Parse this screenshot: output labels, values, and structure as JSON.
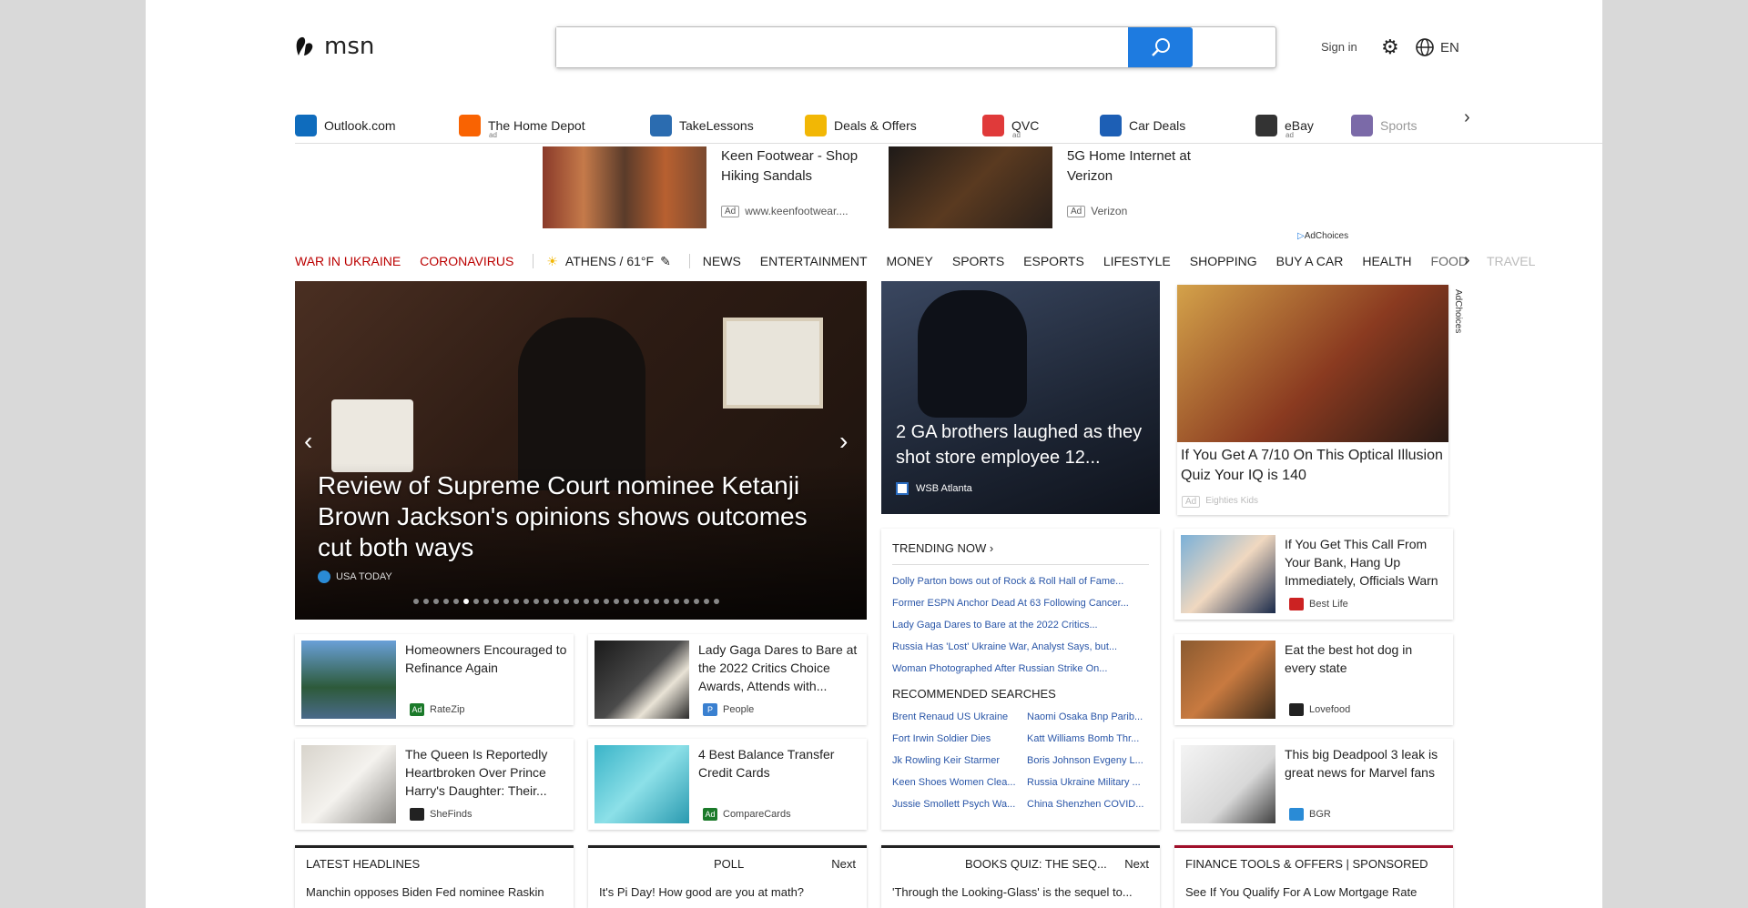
{
  "header": {
    "logo_text": "msn",
    "search_placeholder": "",
    "sign_in": "Sign in",
    "language": "EN"
  },
  "quick_links": [
    {
      "label": "Outlook.com",
      "ad": "",
      "icon": "outlook-icon",
      "color": "#0f6cbd"
    },
    {
      "label": "The Home Depot",
      "ad": "ad",
      "icon": "home-depot-icon",
      "color": "#f96302"
    },
    {
      "label": "TakeLessons",
      "ad": "",
      "icon": "takelessons-icon",
      "color": "#2b6cb0"
    },
    {
      "label": "Deals & Offers",
      "ad": "",
      "icon": "deals-icon",
      "color": "#f2b705"
    },
    {
      "label": "QVC",
      "ad": "ad",
      "icon": "qvc-icon",
      "color": "#e03a3a"
    },
    {
      "label": "Car Deals",
      "ad": "",
      "icon": "car-icon",
      "color": "#1d5fb5"
    },
    {
      "label": "eBay",
      "ad": "ad",
      "icon": "ebay-icon",
      "color": "#333333"
    },
    {
      "label": "Sports",
      "ad": "",
      "icon": "sports-icon",
      "color": "#7b6aa8"
    }
  ],
  "ads": [
    {
      "title": "Keen Footwear - Shop Hiking Sandals",
      "badge": "Ad",
      "source": "www.keenfootwear...."
    },
    {
      "title": "5G Home Internet at Verizon",
      "badge": "Ad",
      "source": "Verizon"
    }
  ],
  "adchoices": "AdChoices",
  "nav": {
    "items": [
      "WAR IN UKRAINE",
      "CORONAVIRUS",
      "ATHENS / 61°F",
      "NEWS",
      "ENTERTAINMENT",
      "MONEY",
      "SPORTS",
      "ESPORTS",
      "LIFESTYLE",
      "SHOPPING",
      "BUY A CAR",
      "HEALTH",
      "FOOD",
      "TRAVEL"
    ]
  },
  "hero": {
    "title": "Review of Supreme Court nominee Ketanji Brown Jackson's opinions shows outcomes cut both ways",
    "source": "USA TODAY",
    "slide_count": 31,
    "active_slide": 5
  },
  "card2": {
    "title": "2 GA brothers laughed as they shot store employee 12...",
    "source": "WSB Atlanta"
  },
  "card3": {
    "title": "If You Get A 7/10 On This Optical Illusion Quiz Your IQ is 140",
    "badge": "Ad",
    "source": "Eighties Kids"
  },
  "trending": {
    "header": "TRENDING NOW",
    "items": [
      "Dolly Parton bows out of Rock & Roll Hall of Fame...",
      "Former ESPN Anchor Dead At 63 Following Cancer...",
      "Lady Gaga Dares to Bare at the 2022 Critics...",
      "Russia Has 'Lost' Ukraine War, Analyst Says, but...",
      "Woman Photographed After Russian Strike On..."
    ],
    "searches_header": "RECOMMENDED SEARCHES",
    "searches": [
      "Brent Renaud US Ukraine",
      "Naomi Osaka Bnp Parib...",
      "Fort Irwin Soldier Dies",
      "Katt Williams Bomb Thr...",
      "Jk Rowling Keir Starmer",
      "Boris Johnson Evgeny L...",
      "Keen Shoes Women Clea...",
      "Russia Ukraine Military ...",
      "Jussie Smollett Psych Wa...",
      "China Shenzhen COVID..."
    ]
  },
  "small_cards": [
    {
      "title": "Homeowners Encouraged to Refinance Again",
      "badge": "Ad",
      "source": "RateZip"
    },
    {
      "title": "Lady Gaga Dares to Bare at the 2022 Critics Choice Awards, Attends with...",
      "badge": "P",
      "source": "People"
    },
    {
      "title": "If You Get This Call From Your Bank, Hang Up Immediately, Officials Warn",
      "badge": "",
      "source": "Best Life"
    },
    {
      "title": "The Queen Is Reportedly Heartbroken Over Prince Harry's Daughter: Their...",
      "badge": "",
      "source": "SheFinds"
    },
    {
      "title": "4 Best Balance Transfer Credit Cards",
      "badge": "Ad",
      "source": "CompareCards"
    },
    {
      "title": "Eat the best hot dog in every state",
      "badge": "",
      "source": "Lovefood"
    },
    {
      "title": "This big Deadpool 3 leak is great news for Marvel fans",
      "badge": "",
      "source": "BGR"
    }
  ],
  "bottom": [
    {
      "title": "LATEST HEADLINES",
      "right": "",
      "body": "Manchin opposes Biden Fed nominee Raskin"
    },
    {
      "title": "POLL",
      "right": "Next",
      "body": "It's Pi Day! How good are you at math?"
    },
    {
      "title": "BOOKS QUIZ: THE SEQ...",
      "right": "Next",
      "body": "'Through the Looking-Glass' is the sequel to..."
    },
    {
      "title": "FINANCE TOOLS & OFFERS | SPONSORED",
      "right": "",
      "body": "See If You Qualify For A Low Mortgage Rate"
    }
  ]
}
